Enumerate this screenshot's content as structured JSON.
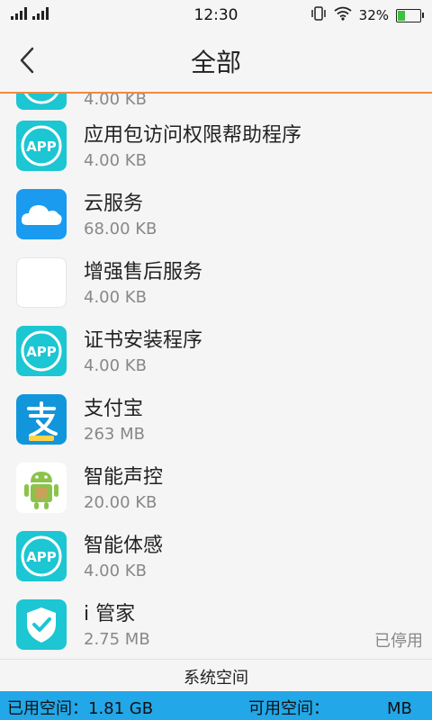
{
  "status_bar": {
    "time": "12:30",
    "battery_percent_label": "32%",
    "battery_level": 0.32,
    "icons": [
      "signal-icon",
      "signal-icon",
      "vibrate-icon",
      "wifi-icon",
      "battery-icon"
    ]
  },
  "header": {
    "title": "全部",
    "back_icon": "chevron-left-icon"
  },
  "apps": [
    {
      "name": "",
      "size": "4.00 KB",
      "icon": "app-generic-icon",
      "state": ""
    },
    {
      "name": "应用包访问权限帮助程序",
      "size": "4.00 KB",
      "icon": "app-generic-icon",
      "state": ""
    },
    {
      "name": "云服务",
      "size": "68.00 KB",
      "icon": "cloud-icon",
      "state": ""
    },
    {
      "name": "增强售后服务",
      "size": "4.00 KB",
      "icon": "blank-icon",
      "state": ""
    },
    {
      "name": "证书安装程序",
      "size": "4.00 KB",
      "icon": "app-generic-icon",
      "state": ""
    },
    {
      "name": "支付宝",
      "size": "263 MB",
      "icon": "alipay-icon",
      "state": ""
    },
    {
      "name": "智能声控",
      "size": "20.00 KB",
      "icon": "android-icon",
      "state": ""
    },
    {
      "name": "智能体感",
      "size": "4.00 KB",
      "icon": "app-generic-icon",
      "state": ""
    },
    {
      "name": "i 管家",
      "size": "2.75 MB",
      "icon": "shield-check-icon",
      "state": "已停用"
    }
  ],
  "footer": {
    "section_label": "系统空间",
    "used_label": "已用空间：1.81 GB",
    "available_label": "可用空间：",
    "available_value": "MB"
  },
  "colors": {
    "accent_orange": "#f28a3c",
    "app_teal": "#1cc6d2",
    "storage_blue": "#22a7e8",
    "alipay_blue": "#1296db"
  }
}
